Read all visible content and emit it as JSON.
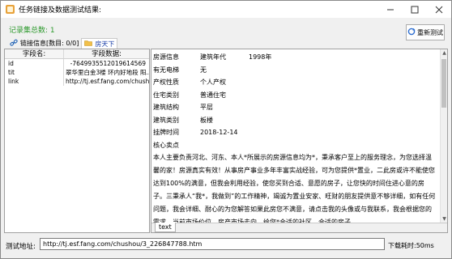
{
  "window": {
    "title": "任务链接及数据测试结果:"
  },
  "summary": {
    "record_count_text": "记录集总数: 1"
  },
  "toolbar": {
    "retest_label": "重新测试"
  },
  "tabs": [
    {
      "label": "链接信息[数目: 0/0]"
    },
    {
      "label": "房天下"
    }
  ],
  "grid": {
    "headers": {
      "name": "字段名:",
      "data": "字段数据:"
    },
    "rows": [
      {
        "name": "id",
        "value": "-7649935512019614569"
      },
      {
        "name": "tit",
        "value": "翠华里白金3楼 环内好地段 阳..."
      },
      {
        "name": "link",
        "value": "http://tj.esf.fang.com/chush..."
      }
    ]
  },
  "detail": {
    "rows": [
      {
        "k": "房源信息",
        "v": "建筑年代",
        "v2": "1998年"
      },
      {
        "k": "有无电梯",
        "v": "无",
        "v2": ""
      },
      {
        "k": "产权性质",
        "v": "个人产权",
        "v2": ""
      },
      {
        "k": "住宅类别",
        "v": "普通住宅",
        "v2": ""
      },
      {
        "k": "建筑结构",
        "v": "平层",
        "v2": ""
      },
      {
        "k": "建筑类别",
        "v": "板楼",
        "v2": ""
      },
      {
        "k": "挂牌时间",
        "v": "2018-12-14",
        "v2": ""
      },
      {
        "k": "核心卖点",
        "v": "",
        "v2": ""
      }
    ],
    "paragraph": "本人主要负责河北、河东、本人*所展示的房源信息均为*，秉承客户至上的服务理念，为您选择温馨的家！房源真实有效！从事房产事业多年丰富实战经验，可为您提供*置业，二此房或许不能使您达到100%的满意，但我会利用经验，使您买到合适、意愿的房子，让您快的时间住进心意的房子。三秉承人“我*，我做到”的工作精神，竭诚为置业安家、旺财的朋友提供意不够详细，如有任何问题，我会详细、耐心的为您解答如果此房您不满意，请点击我的头像或与我联系，我会根据您的需求，当前市场价位，房产市场走向，给您*合适的社区，合适的房子。",
    "bottom_tab": "text"
  },
  "footer": {
    "label": "测试地址:",
    "url": "http://tj.esf.fang.com/chushou/3_226847788.htm",
    "elapsed": "下载耗时:50ms"
  },
  "colors": {
    "success": "#2e9a2e",
    "link": "#1a3ea8"
  }
}
